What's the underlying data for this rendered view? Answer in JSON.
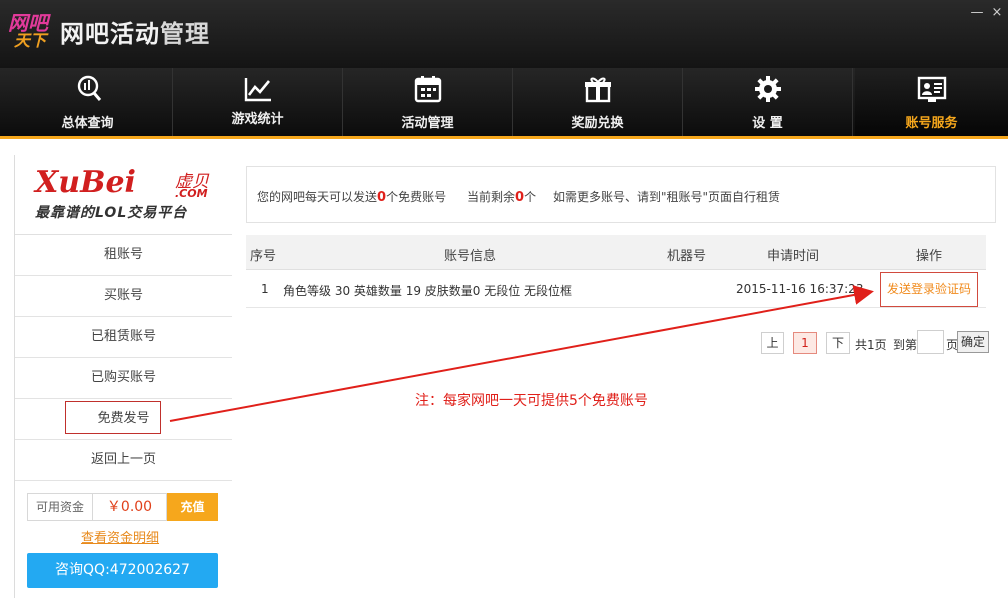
{
  "app": {
    "title_main": "网吧活动",
    "title_tail": "管理",
    "logo_text": "网吧",
    "logo_sub": "天下"
  },
  "nav": [
    {
      "label": "总体查询",
      "icon": "query-chart-icon"
    },
    {
      "label": "游戏统计",
      "icon": "line-chart-icon"
    },
    {
      "label": "活动管理",
      "icon": "calendar-icon"
    },
    {
      "label": "奖励兑换",
      "icon": "gift-icon"
    },
    {
      "label": "设 置",
      "icon": "gear-icon"
    },
    {
      "label": "账号服务",
      "icon": "id-card-icon"
    }
  ],
  "colors": {
    "accent": "#f6a71c",
    "highlight_red": "#e0201a",
    "qq_blue": "#23a9f2"
  },
  "sidebar": {
    "brand": {
      "logo": "XuBei",
      "cn": "虚贝",
      "com": ".COM",
      "slogan": "最靠谱的LOL交易平台"
    },
    "items": [
      "租账号",
      "买账号",
      "已租赁账号",
      "已购买账号",
      "免费发号",
      "返回上一页"
    ],
    "funds_label": "可用资金",
    "funds_value": "￥0.00",
    "recharge": "充值",
    "funds_link": "查看资金明细",
    "qq": "咨询QQ:472002627"
  },
  "notice": {
    "part1": "您的网吧每天可以发送",
    "count1": "0",
    "part2": "个免费账号",
    "part3": "当前剩余",
    "count2": "0",
    "part4": "个",
    "part5": "如需更多账号、请到\"租账号\"页面自行租赁"
  },
  "table": {
    "headers": [
      "序号",
      "账号信息",
      "机器号",
      "申请时间",
      "操作"
    ],
    "rows": [
      {
        "index": "1",
        "info": "角色等级 30 英雄数量 19 皮肤数量0 无段位 无段位框",
        "machine": "",
        "time": "2015-11-16 16:37:23",
        "action": "发送登录验证码"
      }
    ]
  },
  "pagination": {
    "prev": "上",
    "current": "1",
    "next": "下",
    "total": "共1页",
    "goto": "到第",
    "page_suffix": "页",
    "confirm": "确定"
  },
  "annotation": "注：每家网吧一天可提供5个免费账号"
}
